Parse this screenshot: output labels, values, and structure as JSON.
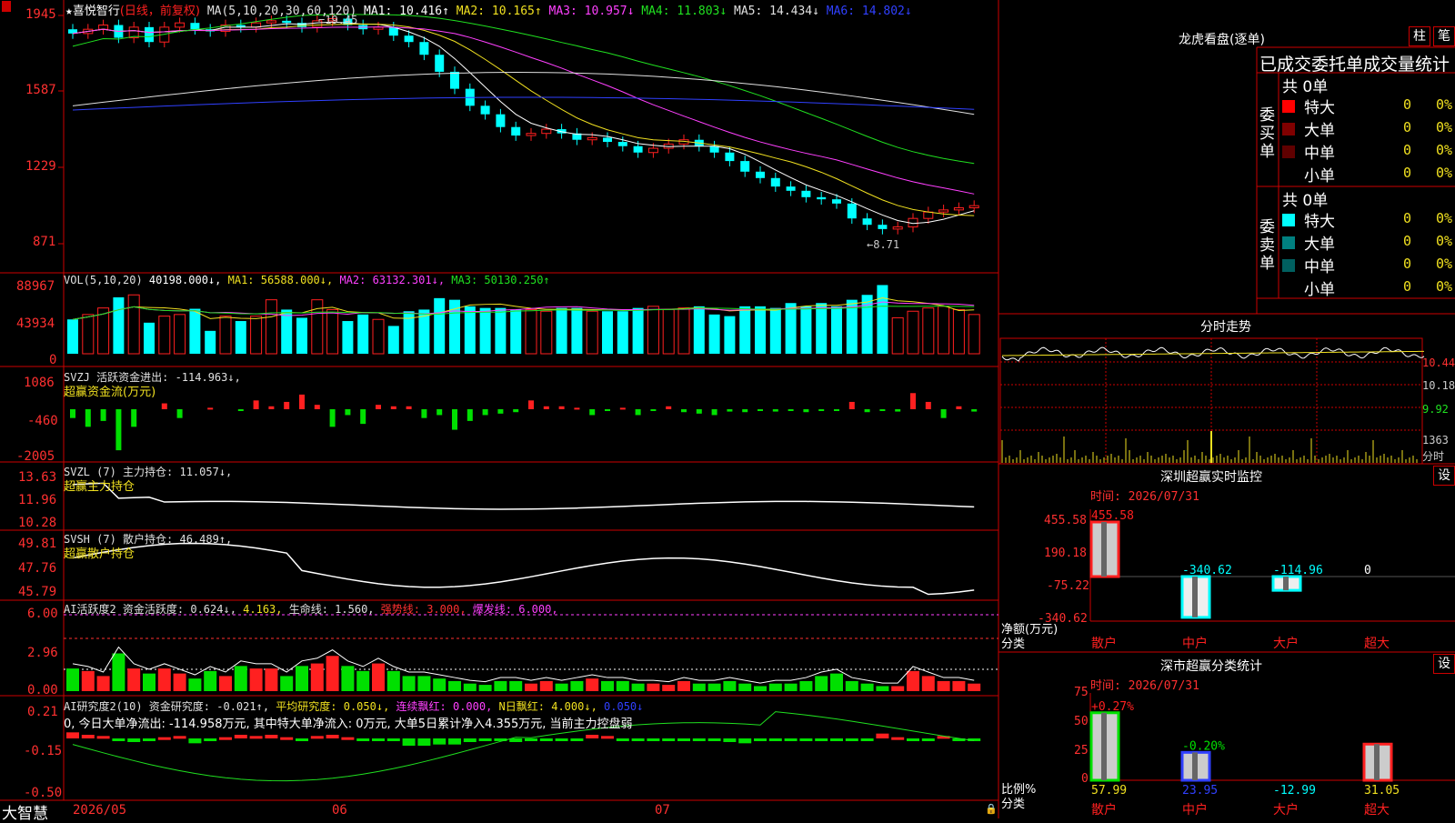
{
  "stock": {
    "star": "★",
    "name": "喜悦智行",
    "mode": "(日线，前复权)"
  },
  "ma_legend": [
    {
      "text": "MA(5,10,20,30,60,120)",
      "color": "#e0e0e0"
    },
    {
      "text": "MA1: 10.416↑",
      "color": "#ffffff"
    },
    {
      "text": "MA2: 10.165↑",
      "color": "#f0e020"
    },
    {
      "text": "MA3: 10.957↓",
      "color": "#ff40ff"
    },
    {
      "text": "MA4: 11.803↓",
      "color": "#20e020"
    },
    {
      "text": "MA5: 14.434↓",
      "color": "#e0e0e0"
    },
    {
      "text": "MA6: 14.802↓",
      "color": "#3040ff"
    }
  ],
  "price_axis": [
    "1945",
    "1587",
    "1229",
    "871"
  ],
  "price_marks": {
    "high": "19.45",
    "low": "8.71"
  },
  "vol": {
    "legend": [
      {
        "text": "VOL(5,10,20)",
        "color": "#e0e0e0"
      },
      {
        "text": "40198.000↓,",
        "color": "#ffffff"
      },
      {
        "text": "MA1: 56588.000↓,",
        "color": "#f0e020"
      },
      {
        "text": "MA2: 63132.301↓,",
        "color": "#ff40ff"
      },
      {
        "text": "MA3: 50130.250↑",
        "color": "#20e020"
      }
    ],
    "axis": [
      "88967",
      "43934",
      "0"
    ]
  },
  "svzj": {
    "legend": "SVZJ  活跃资金进出: -114.963↓,",
    "sub": "超赢资金流(万元)",
    "axis": [
      "1086",
      "-460",
      "-2005"
    ]
  },
  "svzl": {
    "legend": "SVZL (7) 主力持仓: 11.057↓,",
    "sub": "超赢主力持仓",
    "axis": [
      "13.63",
      "11.96",
      "10.28"
    ]
  },
  "svsh": {
    "legend": "SVSH (7) 散户持仓: 46.489↑,",
    "sub": "超赢散户持仓",
    "axis": [
      "49.81",
      "47.76",
      "45.79"
    ]
  },
  "ai1": {
    "legend": [
      {
        "text": "AI活跃度2 资金活跃度: 0.624↓,",
        "color": "#e0e0e0"
      },
      {
        "text": "4.163,",
        "color": "#f0e020"
      },
      {
        "text": "生命线: 1.560,",
        "color": "#e0e0e0"
      },
      {
        "text": "强势线: 3.000,",
        "color": "#ff3030"
      },
      {
        "text": "爆发线: 6.000,",
        "color": "#ff40ff"
      }
    ],
    "axis": [
      "6.00",
      "2.96",
      "0.00"
    ]
  },
  "ai2": {
    "legend": [
      {
        "text": "AI研究度2(10) 资金研究度: -0.021↑,",
        "color": "#e0e0e0"
      },
      {
        "text": "平均研究度: 0.050↓,",
        "color": "#f0e020"
      },
      {
        "text": "连续飘红: 0.000,",
        "color": "#ff40ff"
      },
      {
        "text": "N日飘红: 4.000↓,",
        "color": "#f0e020"
      },
      {
        "text": "0.050↓",
        "color": "#3040ff"
      }
    ],
    "note": "0, 今日大单净流出: -114.958万元, 其中特大单净流入: 0万元, 大单5日累计净入4.355万元, 当前主力控盘弱",
    "axis": [
      "0.21",
      "-0.15",
      "-0.50"
    ]
  },
  "bottom": {
    "brand": "大智慧",
    "months": [
      "2026/05",
      "06",
      "07"
    ]
  },
  "lhb": {
    "title": "龙虎看盘(逐单)",
    "btn1": "柱",
    "btn2": "笔",
    "header": "已成交委托单成交量统计",
    "buy": {
      "label": "委买单",
      "total": "共 0单",
      "rows": [
        {
          "name": "特大",
          "val": "0",
          "pct": "0%",
          "color": "#ff0000"
        },
        {
          "name": "大单",
          "val": "0",
          "pct": "0%",
          "color": "#800000"
        },
        {
          "name": "中单",
          "val": "0",
          "pct": "0%",
          "color": "#600000"
        },
        {
          "name": "小单",
          "val": "0",
          "pct": "0%",
          "color": "#000000"
        }
      ]
    },
    "sell": {
      "label": "委卖单",
      "total": "共 0单",
      "rows": [
        {
          "name": "特大",
          "val": "0",
          "pct": "0%",
          "color": "#00ffff"
        },
        {
          "name": "大单",
          "val": "0",
          "pct": "0%",
          "color": "#008080"
        },
        {
          "name": "中单",
          "val": "0",
          "pct": "0%",
          "color": "#006060"
        },
        {
          "name": "小单",
          "val": "0",
          "pct": "0%",
          "color": "#000000"
        }
      ]
    }
  },
  "fenshi": {
    "title": "分时走势",
    "price_axis": [
      "10.44",
      "10.18",
      "9.92"
    ],
    "vol_axis": "1363",
    "vol_label": "分时"
  },
  "sz_monitor": {
    "title": "深圳超赢实时监控",
    "btn": "设",
    "time": "时间: 2026/07/31",
    "axis": [
      "455.58",
      "190.18",
      "-75.22",
      "-340.62"
    ],
    "ylabel": "净额(万元)",
    "xlabel": "分类"
  },
  "sz_stats": {
    "title": "深市超赢分类统计",
    "btn": "设",
    "time": "时间: 2026/07/31",
    "axis": [
      "75",
      "50",
      "25",
      "0"
    ],
    "ylabel": "比例%",
    "xlabel": "分类"
  },
  "chart_data": [
    {
      "type": "bar",
      "title": "深圳超赢实时监控",
      "ylabel": "净额(万元)",
      "xlabel": "分类",
      "categories": [
        "散户",
        "中户",
        "大户",
        "超大"
      ],
      "values": [
        455.58,
        -340.62,
        -114.96,
        0
      ],
      "labels": [
        "455.58",
        "-340.62",
        "-114.96",
        "0"
      ],
      "ylim": [
        -340.62,
        455.58
      ]
    },
    {
      "type": "bar",
      "title": "深市超赢分类统计",
      "ylabel": "比例%",
      "xlabel": "分类",
      "categories": [
        "散户",
        "中户",
        "大户",
        "超大"
      ],
      "values": [
        57.99,
        23.95,
        -12.99,
        31.05
      ],
      "labels": [
        "57.99",
        "23.95",
        "-12.99",
        "31.05"
      ],
      "changes": [
        "+0.27%",
        "-0.20%",
        "",
        ""
      ],
      "ylim": [
        0,
        75
      ]
    }
  ]
}
